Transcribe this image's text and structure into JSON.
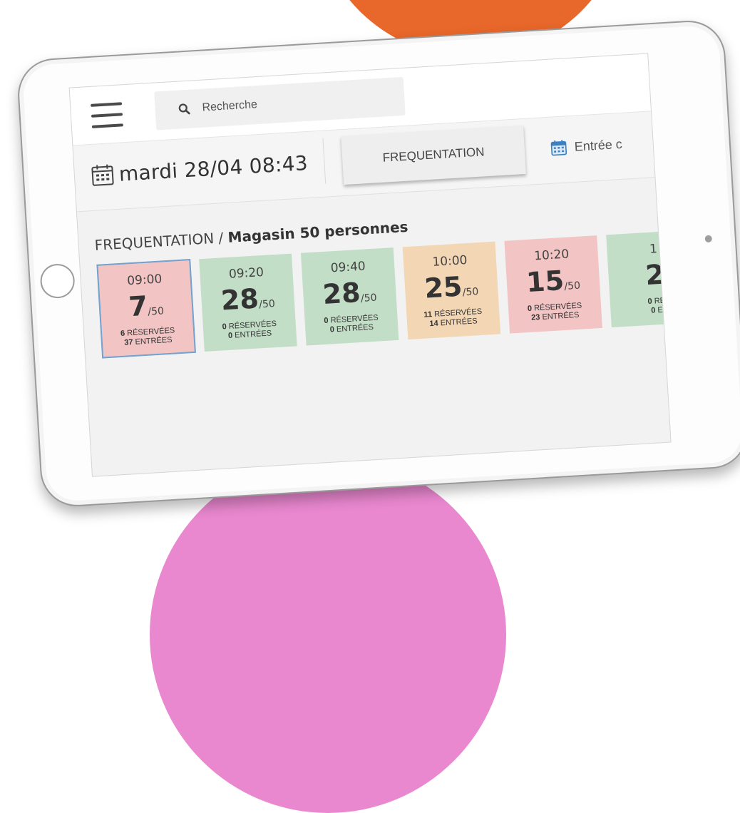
{
  "search": {
    "placeholder": "Recherche"
  },
  "subbar": {
    "date": "mardi 28/04 08:43",
    "tabs": [
      {
        "label": "FREQUENTATION"
      },
      {
        "label": "Entrée c"
      }
    ]
  },
  "content": {
    "title_prefix": "FREQUENTATION / ",
    "title_store": "Magasin 50 personnes"
  },
  "slots": [
    {
      "time": "09:00",
      "available": "7",
      "capacity": "/50",
      "reserved_num": "6",
      "reserved_label": "RÉSERVÉES",
      "entries_num": "37",
      "entries_label": "ENTRÉES"
    },
    {
      "time": "09:20",
      "available": "28",
      "capacity": "/50",
      "reserved_num": "0",
      "reserved_label": "RÉSERVÉES",
      "entries_num": "0",
      "entries_label": "ENTRÉES"
    },
    {
      "time": "09:40",
      "available": "28",
      "capacity": "/50",
      "reserved_num": "0",
      "reserved_label": "RÉSERVÉES",
      "entries_num": "0",
      "entries_label": "ENTRÉES"
    },
    {
      "time": "10:00",
      "available": "25",
      "capacity": "/50",
      "reserved_num": "11",
      "reserved_label": "RÉSERVÉES",
      "entries_num": "14",
      "entries_label": "ENTRÉES"
    },
    {
      "time": "10:20",
      "available": "15",
      "capacity": "/50",
      "reserved_num": "0",
      "reserved_label": "RÉSERVÉES",
      "entries_num": "23",
      "entries_label": "ENTRÉES"
    },
    {
      "time": "1",
      "available": "2",
      "capacity": "",
      "reserved_num": "0",
      "reserved_label": "RÉ",
      "entries_num": "0",
      "entries_label": "E"
    }
  ],
  "colors": {
    "slot_red": "#f2c4c4",
    "slot_green": "#c3dec7",
    "slot_orange": "#f3d7b5",
    "selected_border": "#6aa0cf",
    "accent_top": "#e8672a",
    "accent_bottom": "#e987cf"
  },
  "icons": [
    "menu-icon",
    "search-icon",
    "calendar-icon"
  ]
}
